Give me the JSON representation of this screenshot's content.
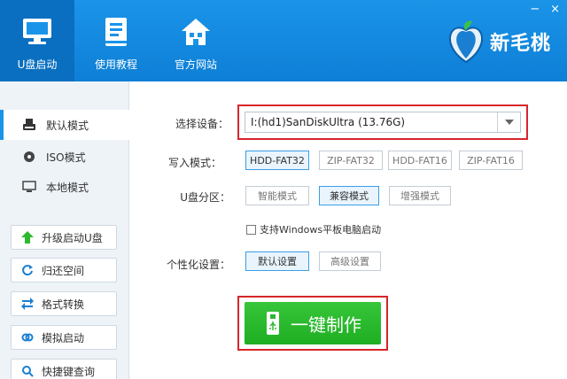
{
  "header": {
    "nav": [
      {
        "label": "U盘启动",
        "icon": "monitor-icon"
      },
      {
        "label": "使用教程",
        "icon": "tutorial-icon"
      },
      {
        "label": "官方网站",
        "icon": "home-icon"
      }
    ],
    "window_controls": [
      "−",
      "×"
    ],
    "brand_name": "新毛桃",
    "colors": {
      "header": "#1a94e8",
      "active_nav": "#0a6fc0"
    }
  },
  "sidebar": {
    "modes": [
      {
        "label": "默认模式",
        "icon": "usb-drive-icon"
      },
      {
        "label": "ISO模式",
        "icon": "disc-icon"
      },
      {
        "label": "本地模式",
        "icon": "desktop-icon"
      }
    ],
    "tools": [
      {
        "label": "升级启动U盘",
        "icon": "upgrade-arrow-icon"
      },
      {
        "label": "归还空间",
        "icon": "restore-icon"
      },
      {
        "label": "格式转换",
        "icon": "convert-icon"
      },
      {
        "label": "模拟启动",
        "icon": "simulate-icon"
      },
      {
        "label": "快捷键查询",
        "icon": "search-icon"
      }
    ]
  },
  "main": {
    "device": {
      "label": "选择设备：",
      "value": "I:(hd1)SanDiskUltra (13.76G)"
    },
    "write_mode": {
      "label": "写入模式：",
      "options": [
        "HDD-FAT32",
        "ZIP-FAT32",
        "HDD-FAT16",
        "ZIP-FAT16"
      ],
      "selected": "HDD-FAT32"
    },
    "partition": {
      "label": "U盘分区：",
      "options": [
        "智能模式",
        "兼容模式",
        "增强模式"
      ],
      "selected": "兼容模式"
    },
    "tablet_checkbox": {
      "label": "支持Windows平板电脑启动",
      "checked": false
    },
    "personalize": {
      "label": "个性化设置：",
      "options": [
        "默认设置",
        "高级设置"
      ],
      "selected": "默认设置"
    },
    "make_button": {
      "label": "一键制作",
      "color": "#2db830"
    },
    "highlight_color": "#d7262b"
  }
}
